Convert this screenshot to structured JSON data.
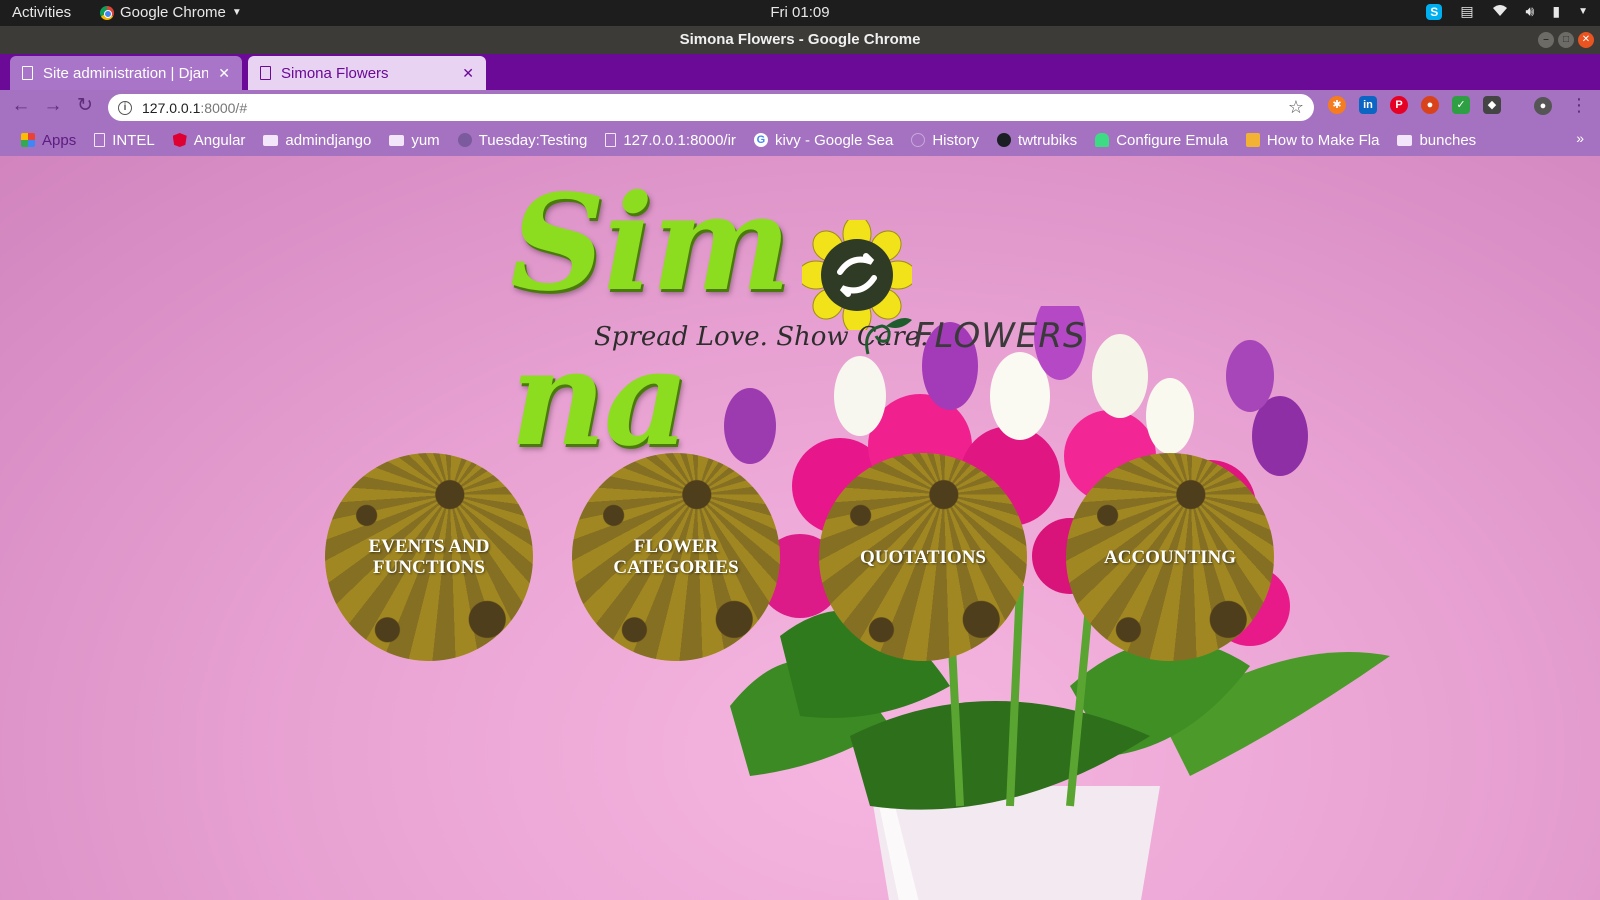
{
  "os_panel": {
    "activities": "Activities",
    "app_name": "Google Chrome",
    "clock": "Fri 01:09"
  },
  "window": {
    "title": "Simona Flowers - Google Chrome"
  },
  "tabs": [
    {
      "title": "Site administration | Djan",
      "active": false
    },
    {
      "title": "Simona Flowers",
      "active": true
    }
  ],
  "toolbar": {
    "url_host": "127.0.0.1",
    "url_rest": ":8000/#"
  },
  "bookmarks": [
    {
      "label": "Apps",
      "icon": "apps-grid-icon"
    },
    {
      "label": "INTEL",
      "icon": "page-icon"
    },
    {
      "label": "Angular",
      "icon": "angular-icon"
    },
    {
      "label": "admindjango",
      "icon": "folder-icon"
    },
    {
      "label": "yum",
      "icon": "folder-icon"
    },
    {
      "label": "Tuesday:Testing",
      "icon": "pin-icon"
    },
    {
      "label": "127.0.0.1:8000/ir",
      "icon": "page-icon"
    },
    {
      "label": "kivy - Google Sea",
      "icon": "google-icon"
    },
    {
      "label": "History",
      "icon": "history-icon"
    },
    {
      "label": "twtrubiks",
      "icon": "github-icon"
    },
    {
      "label": "Configure Emula",
      "icon": "android-icon"
    },
    {
      "label": "How to Make Fla",
      "icon": "bookmark-image-icon"
    },
    {
      "label": "bunches",
      "icon": "folder-icon"
    }
  ],
  "page": {
    "logo": {
      "word_left": "Sim",
      "word_right": "na",
      "tagline": "Spread Love. Show Care.",
      "flowers_word": "FLOWERS"
    },
    "menu": [
      {
        "label": "EVENTS AND FUNCTIONS"
      },
      {
        "label": "FLOWER CATEGORIES"
      },
      {
        "label": "QUOTATIONS"
      },
      {
        "label": "ACCOUNTING"
      }
    ]
  },
  "colors": {
    "tabstrip": "#6a0a97",
    "toolbar": "#a472c0",
    "logo_green": "#8cdc1f",
    "page_pink": "#e9a3d3"
  }
}
